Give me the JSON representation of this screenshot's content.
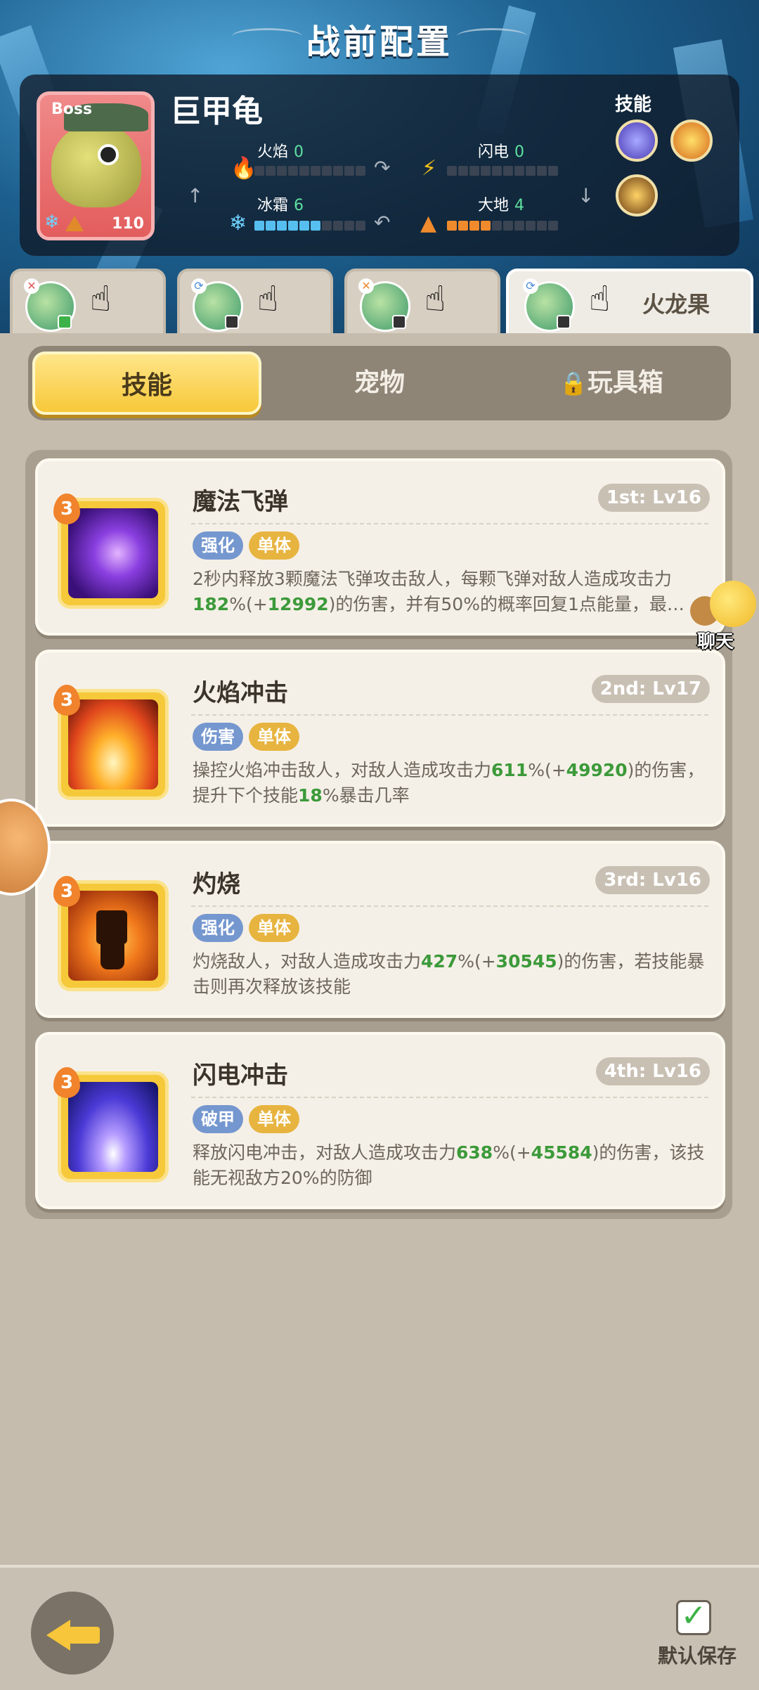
{
  "header": {
    "title": "战前配置"
  },
  "boss": {
    "tag": "Boss",
    "name": "巨甲龟",
    "level": "110",
    "stats": [
      {
        "label": "火焰",
        "value": "0",
        "icon": "fire-icon",
        "filled": 0
      },
      {
        "label": "闪电",
        "value": "0",
        "icon": "lightning-icon",
        "filled": 0
      },
      {
        "label": "冰霜",
        "value": "6",
        "icon": "snowflake-icon",
        "filled": 6
      },
      {
        "label": "大地",
        "value": "4",
        "icon": "mountain-icon",
        "filled": 4
      }
    ],
    "skills_label": "技能"
  },
  "team": [
    {
      "icon": "pet-avatar-icon"
    },
    {
      "icon": "pet-avatar-icon"
    },
    {
      "icon": "pet-avatar-icon"
    },
    {
      "icon": "pet-avatar-icon",
      "name": "火龙果"
    }
  ],
  "tabs": [
    {
      "label": "技能",
      "active": true
    },
    {
      "label": "宠物",
      "active": false
    },
    {
      "label": "玩具箱",
      "active": false,
      "icon": "lock-icon"
    }
  ],
  "skills": [
    {
      "name": "魔法飞弹",
      "level": "1st: Lv16",
      "badge": "3",
      "tags": [
        "强化",
        "单体"
      ],
      "desc_parts": [
        "2秒内释放3颗魔法飞弹攻击敌人，每颗飞弹对敌人造成攻击力",
        "182",
        "%(+",
        "12992",
        ")的伤害，并有50%的概率回复1点能量，最…"
      ]
    },
    {
      "name": "火焰冲击",
      "level": "2nd: Lv17",
      "badge": "3",
      "tags": [
        "伤害",
        "单体"
      ],
      "desc_parts": [
        "操控火焰冲击敌人，对敌人造成攻击力",
        "611",
        "%(+",
        "49920",
        ")的伤害，提升下个技能",
        "18",
        "%暴击几率"
      ]
    },
    {
      "name": "灼烧",
      "level": "3rd: Lv16",
      "badge": "3",
      "tags": [
        "强化",
        "单体"
      ],
      "desc_parts": [
        "灼烧敌人，对敌人造成攻击力",
        "427",
        "%(+",
        "30545",
        ")的伤害，若技能暴击则再次释放该技能"
      ]
    },
    {
      "name": "闪电冲击",
      "level": "4th: Lv16",
      "badge": "3",
      "tags": [
        "破甲",
        "单体"
      ],
      "desc_parts": [
        "释放闪电冲击，对敌人造成攻击力",
        "638",
        "%(+",
        "45584",
        ")的伤害，该技能无视敌方20%的防御"
      ]
    }
  ],
  "chat": {
    "label": "聊天"
  },
  "footer": {
    "save_label": "默认保存",
    "save_checked": true
  }
}
